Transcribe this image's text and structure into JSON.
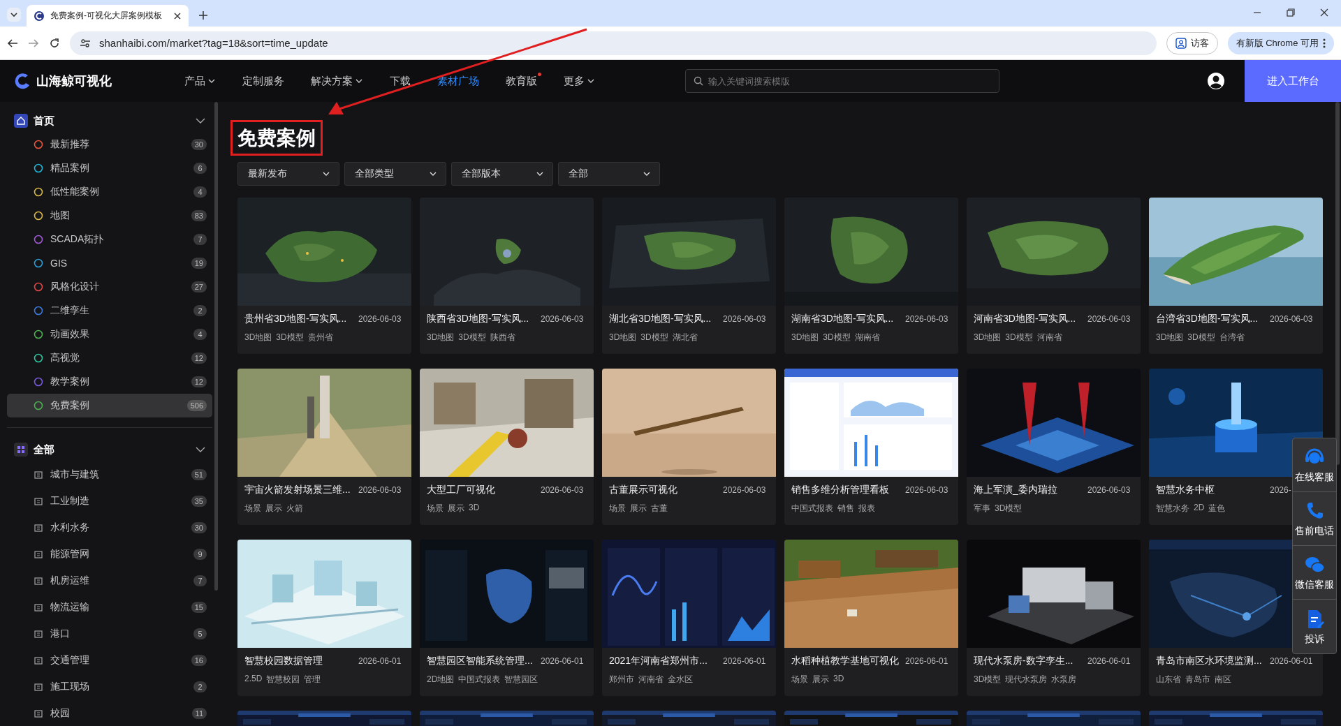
{
  "browser": {
    "tab_title": "免费案例-可视化大屏案例模板",
    "url": "shanhaibi.com/market?tag=18&sort=time_update",
    "profile": "访客",
    "update_button": "有新版 Chrome 可用"
  },
  "nav": {
    "logo": "山海鲸可视化",
    "items": [
      {
        "label": "产品",
        "dropdown": true,
        "selected": false,
        "dot": false
      },
      {
        "label": "定制服务",
        "dropdown": false,
        "selected": false,
        "dot": false
      },
      {
        "label": "解决方案",
        "dropdown": true,
        "selected": false,
        "dot": false
      },
      {
        "label": "下载",
        "dropdown": false,
        "selected": false,
        "dot": false
      },
      {
        "label": "素材广场",
        "dropdown": false,
        "selected": true,
        "dot": false
      },
      {
        "label": "教育版",
        "dropdown": false,
        "selected": false,
        "dot": true
      },
      {
        "label": "更多",
        "dropdown": true,
        "selected": false,
        "dot": false
      }
    ],
    "search": {
      "placeholder": "输入关键词搜索模版"
    },
    "workspace_button": "进入工作台"
  },
  "sidebar": {
    "groups": [
      {
        "title": "首页",
        "expanded": true,
        "items": [
          {
            "label": "最新推荐",
            "count": "30",
            "color": "#e8553b",
            "selected": false
          },
          {
            "label": "精品案例",
            "count": "6",
            "color": "#1fb5d6",
            "selected": false
          },
          {
            "label": "低性能案例",
            "count": "4",
            "color": "#d8b84a",
            "selected": false
          },
          {
            "label": "地图",
            "count": "83",
            "color": "#d8b84a",
            "selected": false
          },
          {
            "label": "SCADA拓扑",
            "count": "7",
            "color": "#a05ad8",
            "selected": false
          },
          {
            "label": "GIS",
            "count": "19",
            "color": "#2a9fd6",
            "selected": false
          },
          {
            "label": "风格化设计",
            "count": "27",
            "color": "#e04848",
            "selected": false
          },
          {
            "label": "二维孪生",
            "count": "2",
            "color": "#3b7be0",
            "selected": false
          },
          {
            "label": "动画效果",
            "count": "4",
            "color": "#4caf50",
            "selected": false
          },
          {
            "label": "高视觉",
            "count": "12",
            "color": "#2ec4a0",
            "selected": false
          },
          {
            "label": "教学案例",
            "count": "12",
            "color": "#7a5ae0",
            "selected": false
          },
          {
            "label": "免费案例",
            "count": "506",
            "color": "#4caf50",
            "selected": true
          }
        ]
      },
      {
        "title": "全部",
        "expanded": true,
        "items": [
          {
            "label": "城市与建筑",
            "count": "51",
            "selected": false
          },
          {
            "label": "工业制造",
            "count": "35",
            "selected": false
          },
          {
            "label": "水利水务",
            "count": "30",
            "selected": false
          },
          {
            "label": "能源管网",
            "count": "9",
            "selected": false
          },
          {
            "label": "机房运维",
            "count": "7",
            "selected": false
          },
          {
            "label": "物流运输",
            "count": "15",
            "selected": false
          },
          {
            "label": "港口",
            "count": "5",
            "selected": false
          },
          {
            "label": "交通管理",
            "count": "16",
            "selected": false
          },
          {
            "label": "施工现场",
            "count": "2",
            "selected": false
          },
          {
            "label": "校园",
            "count": "11",
            "selected": false
          }
        ]
      }
    ]
  },
  "page": {
    "title": "免费案例",
    "filters": [
      "最新发布",
      "全部类型",
      "全部版本",
      "全部"
    ],
    "cards": [
      {
        "title": "贵州省3D地图-写实风...",
        "date": "2026-06-03",
        "tags": [
          "3D地图",
          "3D模型",
          "贵州省"
        ]
      },
      {
        "title": "陕西省3D地图-写实风...",
        "date": "2026-06-03",
        "tags": [
          "3D地图",
          "3D模型",
          "陕西省"
        ]
      },
      {
        "title": "湖北省3D地图-写实风...",
        "date": "2026-06-03",
        "tags": [
          "3D地图",
          "3D模型",
          "湖北省"
        ]
      },
      {
        "title": "湖南省3D地图-写实风...",
        "date": "2026-06-03",
        "tags": [
          "3D地图",
          "3D模型",
          "湖南省"
        ]
      },
      {
        "title": "河南省3D地图-写实风...",
        "date": "2026-06-03",
        "tags": [
          "3D地图",
          "3D模型",
          "河南省"
        ]
      },
      {
        "title": "台湾省3D地图-写实风...",
        "date": "2026-06-03",
        "tags": [
          "3D地图",
          "3D模型",
          "台湾省"
        ]
      },
      {
        "title": "宇宙火箭发射场景三维...",
        "date": "2026-06-03",
        "tags": [
          "场景",
          "展示",
          "火箭"
        ]
      },
      {
        "title": "大型工厂可视化",
        "date": "2026-06-03",
        "tags": [
          "场景",
          "展示",
          "3D"
        ]
      },
      {
        "title": "古董展示可视化",
        "date": "2026-06-03",
        "tags": [
          "场景",
          "展示",
          "古董"
        ]
      },
      {
        "title": "销售多维分析管理看板",
        "date": "2026-06-03",
        "tags": [
          "中国式报表",
          "销售",
          "报表"
        ]
      },
      {
        "title": "海上军演_委内瑞拉",
        "date": "2026-06-03",
        "tags": [
          "军事",
          "3D模型"
        ]
      },
      {
        "title": "智慧水务中枢",
        "date": "2026-",
        "tags": [
          "智慧水务",
          "2D",
          "蓝色"
        ]
      },
      {
        "title": "智慧校园数据管理",
        "date": "2026-06-01",
        "tags": [
          "2.5D",
          "智慧校园",
          "管理"
        ]
      },
      {
        "title": "智慧园区智能系统管理...",
        "date": "2026-06-01",
        "tags": [
          "2D地图",
          "中国式报表",
          "智慧园区"
        ]
      },
      {
        "title": "2021年河南省郑州市...",
        "date": "2026-06-01",
        "tags": [
          "郑州市",
          "河南省",
          "金水区"
        ]
      },
      {
        "title": "水稻种植教学基地可视化",
        "date": "2026-06-01",
        "tags": [
          "场景",
          "展示",
          "3D"
        ]
      },
      {
        "title": "现代水泵房-数字孪生...",
        "date": "2026-06-01",
        "tags": [
          "3D模型",
          "现代水泵房",
          "水泵房"
        ]
      },
      {
        "title": "青岛市南区水环境监测...",
        "date": "2026-06-01",
        "tags": [
          "山东省",
          "青岛市",
          "南区"
        ]
      }
    ]
  },
  "service_panel": [
    {
      "label": "在线客服"
    },
    {
      "label": "售前电话"
    },
    {
      "label": "微信客服"
    },
    {
      "label": "投诉"
    }
  ]
}
